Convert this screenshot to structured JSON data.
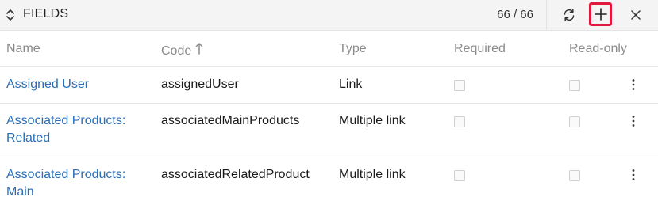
{
  "header": {
    "title": "FIELDS",
    "count": "66 / 66",
    "toggle_icon": "chevron-up-down-icon",
    "actions": [
      {
        "name": "refresh",
        "icon": "refresh-icon"
      },
      {
        "name": "add",
        "icon": "plus-icon",
        "highlight_color": "#e3173b"
      },
      {
        "name": "close",
        "icon": "close-icon"
      }
    ]
  },
  "table": {
    "columns": {
      "name": "Name",
      "code": "Code",
      "code_sort": "ascending",
      "type": "Type",
      "required": "Required",
      "readonly": "Read-only"
    },
    "rows": [
      {
        "name": "Assigned User",
        "code": "assignedUser",
        "type": "Link",
        "required": false,
        "readonly": false
      },
      {
        "name": "Associated Products: Related",
        "code": "associatedMainProducts",
        "type": "Multiple link",
        "required": false,
        "readonly": false
      },
      {
        "name": "Associated Products: Main",
        "code": "associatedRelatedProduct",
        "type": "Multiple link",
        "required": false,
        "readonly": false
      }
    ]
  },
  "colors": {
    "link": "#2a6eb8",
    "header_bg": "#f4f4f4",
    "muted_text": "#8a8a8a",
    "highlight": "#e3173b"
  }
}
